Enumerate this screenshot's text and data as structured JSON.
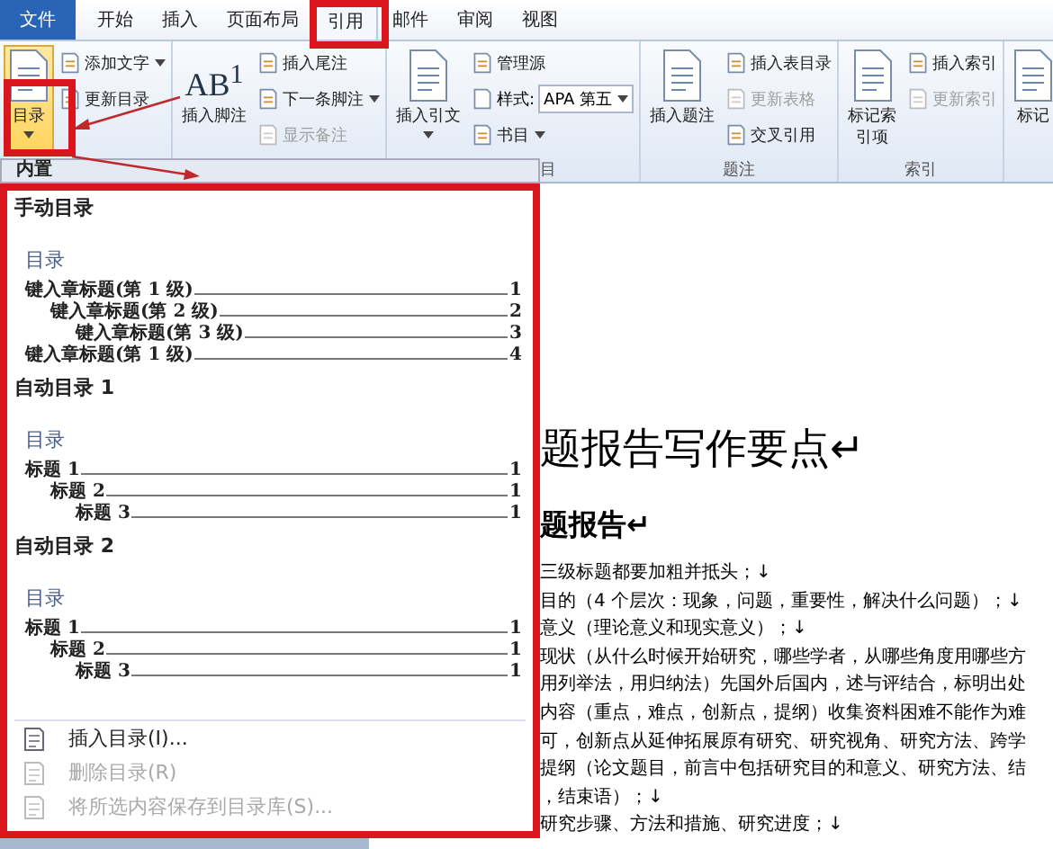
{
  "tabs": [
    {
      "label": "文件",
      "kind": "file",
      "selected": false
    },
    {
      "label": "开始",
      "kind": "tab",
      "selected": false
    },
    {
      "label": "插入",
      "kind": "tab",
      "selected": false
    },
    {
      "label": "页面布局",
      "kind": "tab",
      "selected": false
    },
    {
      "label": "引用",
      "kind": "tab",
      "selected": true
    },
    {
      "label": "邮件",
      "kind": "tab",
      "selected": false
    },
    {
      "label": "审阅",
      "kind": "tab",
      "selected": false
    },
    {
      "label": "视图",
      "kind": "tab",
      "selected": false
    }
  ],
  "ribbon": [
    {
      "columns": [
        [
          {
            "kind": "large",
            "label": "目录",
            "dropdown": true,
            "pressed": true
          }
        ],
        [
          {
            "kind": "small",
            "label": "添加文字",
            "dropdown": true,
            "disabled": false
          },
          {
            "kind": "small",
            "label": "更新目录",
            "dropdown": false,
            "disabled": false
          }
        ]
      ]
    },
    {
      "columns": [
        [
          {
            "kind": "large",
            "label": "插入脚注",
            "glyph": "AB$^{1}$",
            "dropdown": false,
            "pressed": false
          }
        ],
        [
          {
            "kind": "small",
            "label": "插入尾注",
            "dropdown": false,
            "disabled": false
          },
          {
            "kind": "small",
            "label": "下一条脚注",
            "dropdown": true,
            "disabled": false
          },
          {
            "kind": "small",
            "label": "显示备注",
            "dropdown": false,
            "disabled": true
          }
        ]
      ]
    },
    {
      "label": "目",
      "columns": [
        [
          {
            "kind": "large",
            "label": "插入引文",
            "dropdown": true,
            "pressed": false
          }
        ],
        [
          {
            "kind": "small",
            "label": "管理源",
            "dropdown": false,
            "disabled": false
          },
          {
            "kind": "select",
            "label": "样式:",
            "value": "APA 第五"
          },
          {
            "kind": "small",
            "label": "书目",
            "dropdown": true,
            "disabled": false
          }
        ]
      ]
    },
    {
      "label": "题注",
      "columns": [
        [
          {
            "kind": "large",
            "label": "插入题注",
            "dropdown": false,
            "pressed": false
          }
        ],
        [
          {
            "kind": "small",
            "label": "插入表目录",
            "dropdown": false,
            "disabled": false
          },
          {
            "kind": "small",
            "label": "更新表格",
            "dropdown": false,
            "disabled": true
          },
          {
            "kind": "small",
            "label": "交叉引用",
            "dropdown": false,
            "disabled": false
          }
        ]
      ]
    },
    {
      "label": "索引",
      "columns": [
        [
          {
            "kind": "narrow",
            "label": "标记索引项",
            "dropdown": false,
            "pressed": false
          }
        ],
        [
          {
            "kind": "small",
            "label": "插入索引",
            "dropdown": false,
            "disabled": false
          },
          {
            "kind": "small",
            "label": "更新索引",
            "dropdown": false,
            "disabled": true
          }
        ]
      ]
    },
    {
      "columns": [
        [
          {
            "kind": "large",
            "label": "标记",
            "dropdown": false,
            "pressed": false
          }
        ]
      ]
    }
  ],
  "dropdown": {
    "header": "内置",
    "sections": [
      {
        "title": "手动目录",
        "heading": "目录",
        "entries": [
          {
            "text": "键入章标题(第 1 级)",
            "page": "1",
            "children": [
              {
                "text": "键入章标题(第 2 级)",
                "page": "2",
                "children": [
                  {
                    "text": "键入章标题(第 3 级)",
                    "page": "3"
                  }
                ]
              }
            ]
          },
          {
            "text": "键入章标题(第 1 级)",
            "page": "4"
          }
        ]
      },
      {
        "title": "自动目录 1",
        "heading": "目录",
        "entries": [
          {
            "text": "标题 1",
            "page": "1",
            "children": [
              {
                "text": "标题 2",
                "page": "1",
                "children": [
                  {
                    "text": "标题 3",
                    "page": "1"
                  }
                ]
              }
            ]
          }
        ]
      },
      {
        "title": "自动目录 2",
        "heading": "目录",
        "entries": [
          {
            "text": "标题 1",
            "page": "1",
            "children": [
              {
                "text": "标题 2",
                "page": "1",
                "children": [
                  {
                    "text": "标题 3",
                    "page": "1"
                  }
                ]
              }
            ]
          }
        ]
      }
    ],
    "menu": [
      {
        "label": "插入目录(I)...",
        "disabled": false
      },
      {
        "label": "删除目录(R)",
        "disabled": true
      },
      {
        "label": "将所选内容保存到目录库(S)...",
        "disabled": true
      }
    ]
  },
  "document": {
    "title": "题报告写作要点↵",
    "heading": "题报告↵",
    "lines": [
      "三级标题都要加粗并抵头；↓",
      "目的（4 个层次：现象，问题，重要性，解决什么问题）；↓",
      "意义（理论意义和现实意义）；↓",
      "现状（从什么时候开始研究，哪些学者，从哪些角度用哪些方",
      "用列举法，用归纳法）先国外后国内，述与评结合，标明出处",
      "内容（重点，难点，创新点，提纲）收集资料困难不能作为难",
      "可，创新点从延伸拓展原有研究、研究视角、研究方法、跨学",
      "提纲（论文题目，前言中包括研究目的和意义、研究方法、结",
      "，结束语）；↓",
      "研究步骤、方法和措施、研究进度；↓"
    ]
  }
}
